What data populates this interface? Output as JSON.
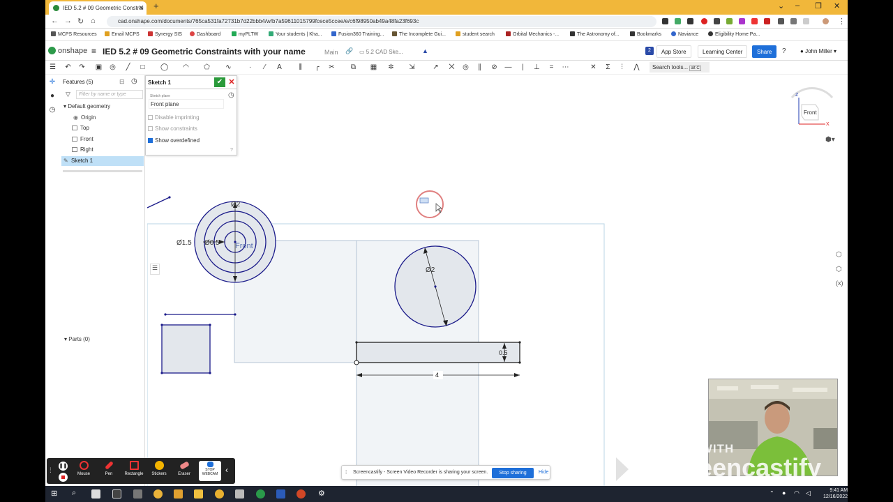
{
  "browser": {
    "tab_title": "IED 5.2 # 09 Geometric Constrai",
    "url": "cad.onshape.com/documents/765ca531fa72731b7d22bbb4/w/b7a59611015799fcece5ccee/e/c6f98950ab49a48fa23f693c",
    "bookmarks": [
      "MCPS Resources",
      "Email MCPS",
      "Synergy SIS",
      "Dashboard",
      "myPLTW",
      "Your students | Kha...",
      "Fusion360 Training...",
      "The Incomplete Gui...",
      "student search",
      "Orbital Mechanics -...",
      "The Astronomy of...",
      "Bookmarks",
      "Naviance",
      "Eligibility Home Pa..."
    ]
  },
  "header": {
    "logo": "onshape",
    "doc_title": "IED 5.2 # 09 Geometric Constraints with your name",
    "branch": "Main",
    "breadcrumb": "5.2 CAD Ske...",
    "notif_count": "2",
    "app_store": "App Store",
    "learning_center": "Learning Center",
    "share": "Share",
    "user": "John Miller"
  },
  "toolbar": {
    "search": "Search tools...",
    "shortcut": "alt C"
  },
  "features": {
    "title": "Features (5)",
    "filter_placeholder": "Filter by name or type",
    "group": "Default geometry",
    "items": [
      "Origin",
      "Top",
      "Front",
      "Right"
    ],
    "sketch": "Sketch 1",
    "parts": "Parts (0)"
  },
  "sketch_dialog": {
    "name": "Sketch 1",
    "plane_label": "Sketch plane",
    "plane_value": "Front plane",
    "options": [
      {
        "label": "Disable imprinting",
        "checked": false
      },
      {
        "label": "Show constraints",
        "checked": false
      },
      {
        "label": "Show overdefined",
        "checked": true
      }
    ]
  },
  "sketch": {
    "plane_label": "Front",
    "dims": {
      "outer_dia": "Ø2",
      "mid_dia": "Ø1.5",
      "inner_dia": "Ø0.5",
      "big_circle": "Ø2",
      "rect_height": "0.5",
      "rect_width": "4"
    }
  },
  "viewcube": {
    "face": "Front",
    "z": "Z",
    "x": "X"
  },
  "share_bar": {
    "text": "Screencastify - Screen Video Recorder is sharing your screen.",
    "stop": "Stop sharing",
    "hide": "Hide"
  },
  "screencastify": {
    "tools": [
      "Mouse",
      "Pen",
      "Rectangle",
      "Stickers",
      "Eraser",
      "STOP WEBCAM"
    ],
    "watermark_top": "MADE WITH",
    "watermark_brand": "Screencastify"
  },
  "taskbar": {
    "time": "9:41 AM",
    "date": "12/16/2022"
  },
  "colors": {
    "sketch_line": "#1b1b8a",
    "region_fill": "#e3e7ec",
    "accent": "#1e6fd9",
    "chrome": "#f1b73a"
  }
}
